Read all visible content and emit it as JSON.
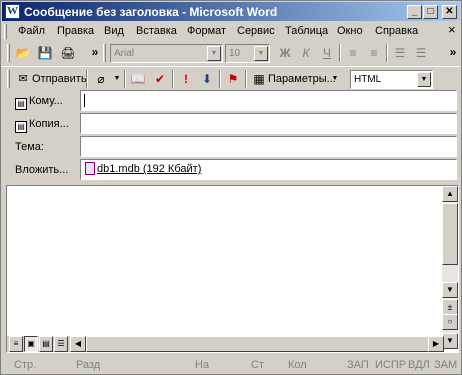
{
  "window": {
    "title": "Сообщение без заголовка - Microsoft Word",
    "app_icon": "W"
  },
  "menu": [
    "Файл",
    "Правка",
    "Вид",
    "Вставка",
    "Формат",
    "Сервис",
    "Таблица",
    "Окно",
    "Справка"
  ],
  "format_toolbar": {
    "font": "Arial",
    "size": "10"
  },
  "mail_toolbar": {
    "send_label": "Отправить",
    "options_label": "Параметры...",
    "format_value": "HTML"
  },
  "headers": {
    "to_label": "Кому...",
    "cc_label": "Копия...",
    "subject_label": "Тема:",
    "attach_label": "Вложить...",
    "attachment": "db1.mdb (192 Кбайт)"
  },
  "status": {
    "page": "Стр.",
    "section": "Разд",
    "at": "На",
    "line": "Ст",
    "col": "Кол",
    "rec": "ЗАП",
    "trk": "ИСПР",
    "ext": "ВДЛ",
    "ovr": "ЗАМ"
  }
}
